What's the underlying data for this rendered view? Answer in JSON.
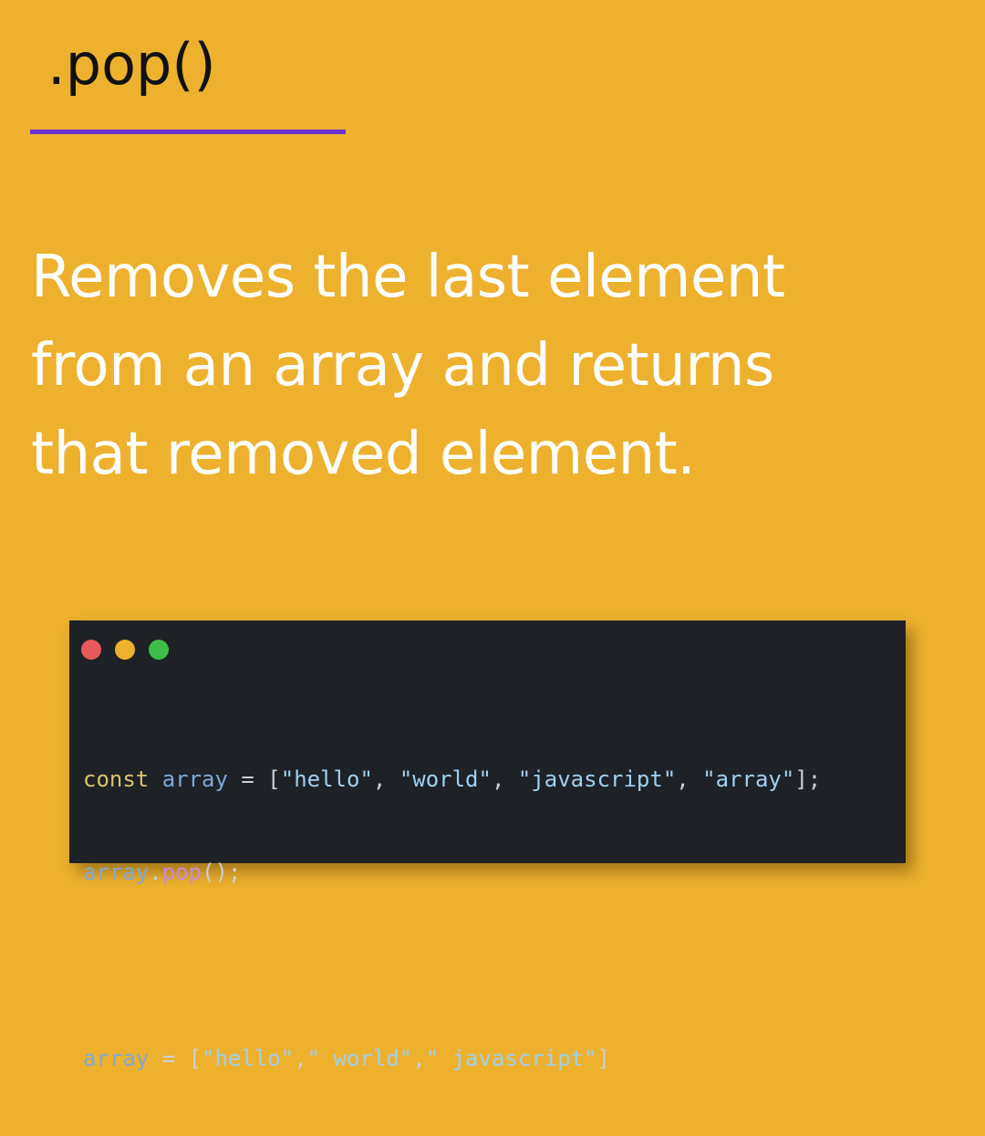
{
  "title": ".pop()",
  "colors": {
    "background": "#EDB12E",
    "underline": "#6D2FCF",
    "code_background": "#1E2126",
    "dot_red": "#E8585A",
    "dot_yellow": "#EDB12E",
    "dot_green": "#3DBE48"
  },
  "description": {
    "lines": [
      "Removes the last element",
      "from an array and returns",
      "that removed element."
    ]
  },
  "code": {
    "line1": {
      "keyword": "const",
      "identifier": "array",
      "operator": " = [",
      "items": [
        "\"hello\"",
        "\"world\"",
        "\"javascript\"",
        "\"array\""
      ],
      "end": "];"
    },
    "line2": {
      "identifier": "array",
      "dot": ".",
      "method": "pop",
      "end": "();"
    },
    "line3": {
      "identifier": "array",
      "operator": " = [",
      "items": [
        "\"hello\"",
        "\" world\"",
        "\" javascript\""
      ],
      "end": "]"
    }
  }
}
